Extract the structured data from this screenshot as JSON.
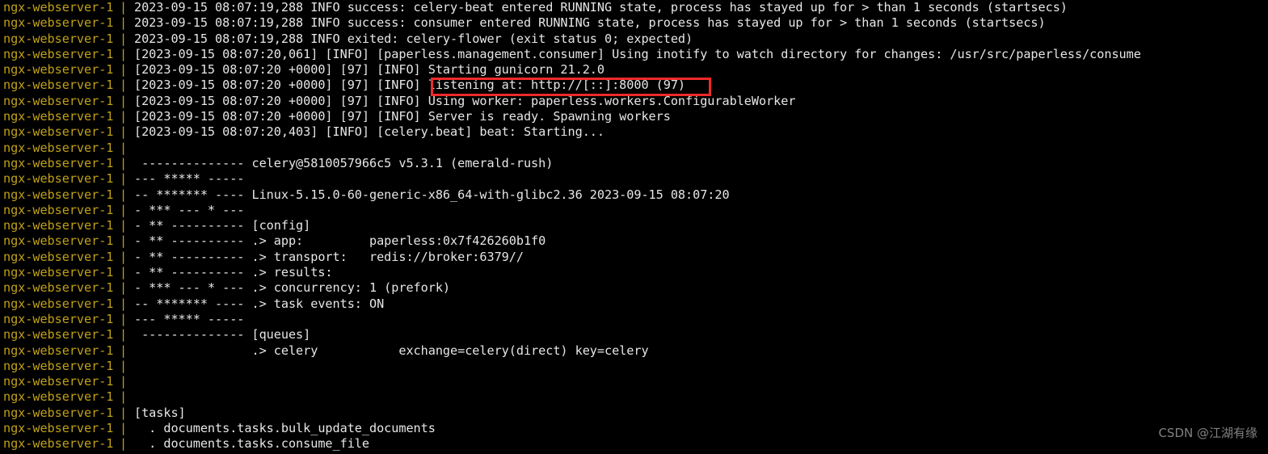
{
  "terminal": {
    "background_color": "#000000",
    "service_label_color": "#bfa019",
    "text_color": "#e6e6e6",
    "highlight_color": "#ef2929",
    "service_name": "ngx-webserver-1",
    "separator": "|"
  },
  "highlight": {
    "target_text": "listening at: http://[::]:8000 (97)",
    "label": "listening-address-highlight"
  },
  "watermark": {
    "text": "CSDN @江湖有缘"
  },
  "lines": [
    {
      "service": "ngx-webserver-1",
      "sep": "|",
      "message": "2023-09-15 08:07:19,288 INFO success: celery-beat entered RUNNING state, process has stayed up for > than 1 seconds (startsecs)"
    },
    {
      "service": "ngx-webserver-1",
      "sep": "|",
      "message": "2023-09-15 08:07:19,288 INFO success: consumer entered RUNNING state, process has stayed up for > than 1 seconds (startsecs)"
    },
    {
      "service": "ngx-webserver-1",
      "sep": "|",
      "message": "2023-09-15 08:07:19,288 INFO exited: celery-flower (exit status 0; expected)"
    },
    {
      "service": "ngx-webserver-1",
      "sep": "|",
      "message": "[2023-09-15 08:07:20,061] [INFO] [paperless.management.consumer] Using inotify to watch directory for changes: /usr/src/paperless/consume"
    },
    {
      "service": "ngx-webserver-1",
      "sep": "|",
      "message": "[2023-09-15 08:07:20 +0000] [97] [INFO] Starting gunicorn 21.2.0"
    },
    {
      "service": "ngx-webserver-1",
      "sep": "|",
      "message": "[2023-09-15 08:07:20 +0000] [97] [INFO] listening at: http://[::]:8000 (97)"
    },
    {
      "service": "ngx-webserver-1",
      "sep": "|",
      "message": "[2023-09-15 08:07:20 +0000] [97] [INFO] Using worker: paperless.workers.ConfigurableWorker"
    },
    {
      "service": "ngx-webserver-1",
      "sep": "|",
      "message": "[2023-09-15 08:07:20 +0000] [97] [INFO] Server is ready. Spawning workers"
    },
    {
      "service": "ngx-webserver-1",
      "sep": "|",
      "message": "[2023-09-15 08:07:20,403] [INFO] [celery.beat] beat: Starting..."
    },
    {
      "service": "ngx-webserver-1",
      "sep": "|",
      "message": ""
    },
    {
      "service": "ngx-webserver-1",
      "sep": "|",
      "message": " -------------- celery@5810057966c5 v5.3.1 (emerald-rush)"
    },
    {
      "service": "ngx-webserver-1",
      "sep": "|",
      "message": "--- ***** ----- "
    },
    {
      "service": "ngx-webserver-1",
      "sep": "|",
      "message": "-- ******* ---- Linux-5.15.0-60-generic-x86_64-with-glibc2.36 2023-09-15 08:07:20"
    },
    {
      "service": "ngx-webserver-1",
      "sep": "|",
      "message": "- *** --- * --- "
    },
    {
      "service": "ngx-webserver-1",
      "sep": "|",
      "message": "- ** ---------- [config]"
    },
    {
      "service": "ngx-webserver-1",
      "sep": "|",
      "message": "- ** ---------- .> app:         paperless:0x7f426260b1f0"
    },
    {
      "service": "ngx-webserver-1",
      "sep": "|",
      "message": "- ** ---------- .> transport:   redis://broker:6379//"
    },
    {
      "service": "ngx-webserver-1",
      "sep": "|",
      "message": "- ** ---------- .> results:     "
    },
    {
      "service": "ngx-webserver-1",
      "sep": "|",
      "message": "- *** --- * --- .> concurrency: 1 (prefork)"
    },
    {
      "service": "ngx-webserver-1",
      "sep": "|",
      "message": "-- ******* ---- .> task events: ON"
    },
    {
      "service": "ngx-webserver-1",
      "sep": "|",
      "message": "--- ***** ----- "
    },
    {
      "service": "ngx-webserver-1",
      "sep": "|",
      "message": " -------------- [queues]"
    },
    {
      "service": "ngx-webserver-1",
      "sep": "|",
      "message": "                .> celery           exchange=celery(direct) key=celery"
    },
    {
      "service": "ngx-webserver-1",
      "sep": "|",
      "message": ""
    },
    {
      "service": "ngx-webserver-1",
      "sep": "|",
      "message": ""
    },
    {
      "service": "ngx-webserver-1",
      "sep": "|",
      "message": ""
    },
    {
      "service": "ngx-webserver-1",
      "sep": "|",
      "message": "[tasks]"
    },
    {
      "service": "ngx-webserver-1",
      "sep": "|",
      "message": "  . documents.tasks.bulk_update_documents"
    },
    {
      "service": "ngx-webserver-1",
      "sep": "|",
      "message": "  . documents.tasks.consume_file"
    }
  ]
}
